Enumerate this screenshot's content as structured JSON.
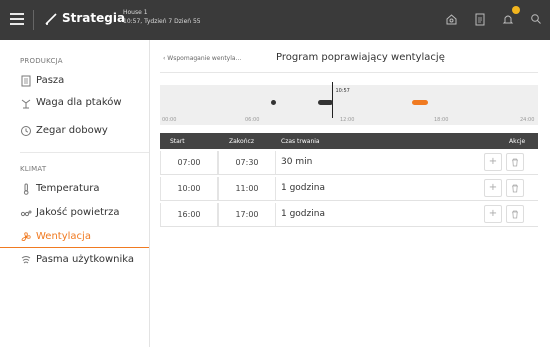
{
  "topbar": {
    "title": "Strategia",
    "house_name": "House 1",
    "house_info": "10:57, Tydzień 7 Dzień 55",
    "icons": [
      "menu-icon",
      "strategia-logo-icon",
      "home-icon",
      "document-icon",
      "bell-icon",
      "search-icon"
    ],
    "notification_color": "#f2b51e"
  },
  "sidebar": {
    "sections": [
      {
        "label": "PRODUKCJA",
        "items": [
          {
            "label": "Pasza",
            "icon": "feed-icon"
          },
          {
            "label": "Waga dla ptaków",
            "icon": "scale-icon"
          },
          {
            "label": "Zegar dobowy",
            "icon": "clock-icon"
          }
        ]
      },
      {
        "label": "KLIMAT",
        "items": [
          {
            "label": "Temperatura",
            "icon": "thermometer-icon"
          },
          {
            "label": "Jakość powietrza",
            "icon": "air-quality-icon"
          },
          {
            "label": "Wentylacja",
            "icon": "ventilation-icon",
            "active": true
          },
          {
            "label": "Pasma użytkownika",
            "icon": "user-band-icon"
          }
        ]
      }
    ],
    "accent_color": "#f07a21"
  },
  "main": {
    "breadcrumb": "‹  Wspomaganie wentyla...",
    "title": "Program poprawiający wentylację",
    "timeline": {
      "ticks": [
        "00:00",
        "06:00",
        "12:00",
        "18:00",
        "24:00"
      ],
      "now_label": "10:57",
      "now_time_hours": 10.95,
      "bars": [
        {
          "start": "07:00",
          "end": "07:30",
          "color": "#333333",
          "shape": "dot"
        },
        {
          "start": "10:00",
          "end": "11:00",
          "color": "#333333",
          "shape": "bar"
        },
        {
          "start": "16:00",
          "end": "17:00",
          "color": "#f07a21",
          "shape": "bar"
        }
      ]
    },
    "table": {
      "columns": [
        "Start",
        "Zakończ",
        "Czas trwania",
        "Akcje"
      ],
      "rows": [
        {
          "start": "07:00",
          "end": "07:30",
          "duration": "30 min"
        },
        {
          "start": "10:00",
          "end": "11:00",
          "duration": "1 godzina"
        },
        {
          "start": "16:00",
          "end": "17:00",
          "duration": "1 godzina"
        }
      ],
      "action_icons": [
        "plus-icon",
        "trash-icon"
      ]
    }
  }
}
